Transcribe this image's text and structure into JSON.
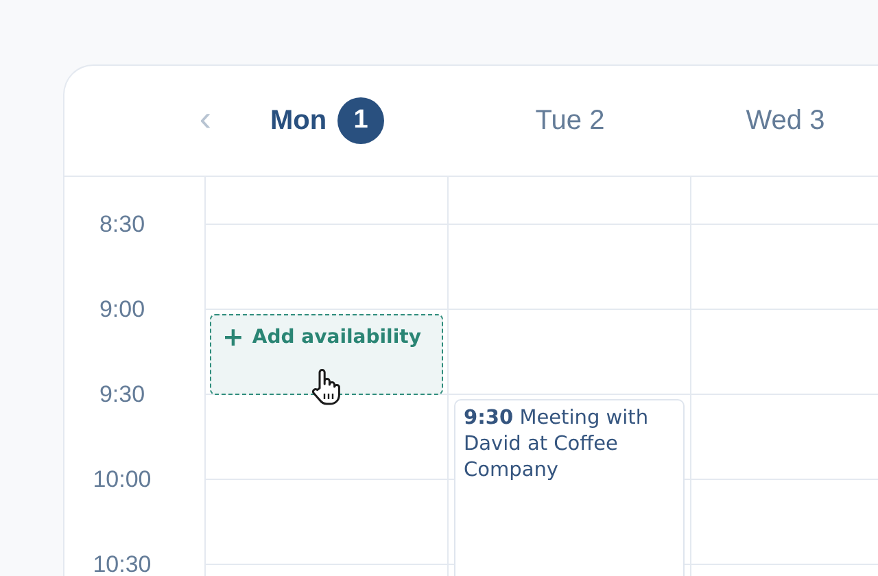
{
  "nav": {
    "previous": "‹"
  },
  "days": [
    {
      "name": "Mon",
      "date": "1",
      "selected": true,
      "events": [
        {
          "kind": "add",
          "label": "Add availability",
          "icon": "+"
        }
      ]
    },
    {
      "name": "Tue",
      "date": "2",
      "selected": false,
      "events": [
        {
          "kind": "event",
          "time": "9:30",
          "title": "Meeting with David at Coffee Company"
        }
      ]
    },
    {
      "name": "Wed",
      "date": "3",
      "selected": false
    }
  ],
  "times": [
    "8:30",
    "9:00",
    "9:30",
    "10:00",
    "10:30"
  ]
}
